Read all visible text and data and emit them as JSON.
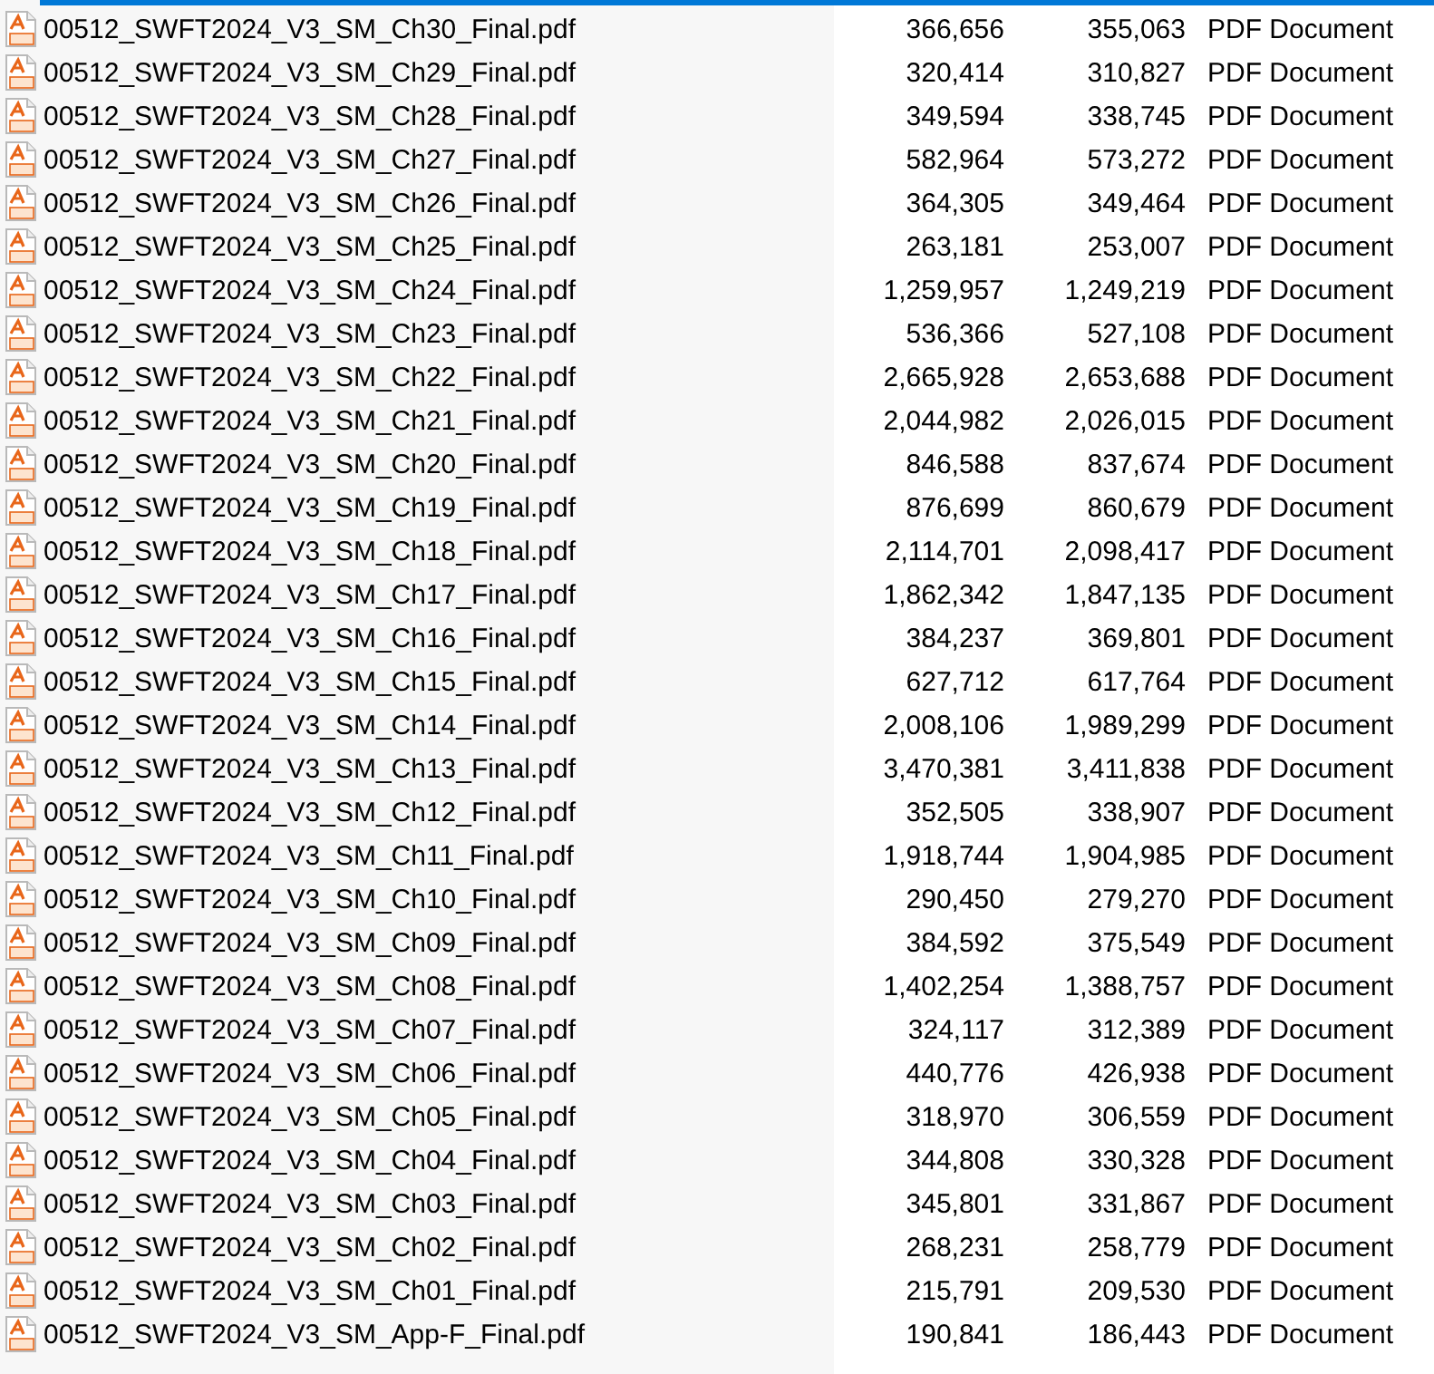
{
  "files": [
    {
      "name": "00512_SWFT2024_V3_SM_Ch30_Final.pdf",
      "column_2": "366,656",
      "column_3": "355,063",
      "column_4": "PDF Document"
    },
    {
      "name": "00512_SWFT2024_V3_SM_Ch29_Final.pdf",
      "column_2": "320,414",
      "column_3": "310,827",
      "column_4": "PDF Document"
    },
    {
      "name": "00512_SWFT2024_V3_SM_Ch28_Final.pdf",
      "column_2": "349,594",
      "column_3": "338,745",
      "column_4": "PDF Document"
    },
    {
      "name": "00512_SWFT2024_V3_SM_Ch27_Final.pdf",
      "column_2": "582,964",
      "column_3": "573,272",
      "column_4": "PDF Document"
    },
    {
      "name": "00512_SWFT2024_V3_SM_Ch26_Final.pdf",
      "column_2": "364,305",
      "column_3": "349,464",
      "column_4": "PDF Document"
    },
    {
      "name": "00512_SWFT2024_V3_SM_Ch25_Final.pdf",
      "column_2": "263,181",
      "column_3": "253,007",
      "column_4": "PDF Document"
    },
    {
      "name": "00512_SWFT2024_V3_SM_Ch24_Final.pdf",
      "column_2": "1,259,957",
      "column_3": "1,249,219",
      "column_4": "PDF Document"
    },
    {
      "name": "00512_SWFT2024_V3_SM_Ch23_Final.pdf",
      "column_2": "536,366",
      "column_3": "527,108",
      "column_4": "PDF Document"
    },
    {
      "name": "00512_SWFT2024_V3_SM_Ch22_Final.pdf",
      "column_2": "2,665,928",
      "column_3": "2,653,688",
      "column_4": "PDF Document"
    },
    {
      "name": "00512_SWFT2024_V3_SM_Ch21_Final.pdf",
      "column_2": "2,044,982",
      "column_3": "2,026,015",
      "column_4": "PDF Document"
    },
    {
      "name": "00512_SWFT2024_V3_SM_Ch20_Final.pdf",
      "column_2": "846,588",
      "column_3": "837,674",
      "column_4": "PDF Document"
    },
    {
      "name": "00512_SWFT2024_V3_SM_Ch19_Final.pdf",
      "column_2": "876,699",
      "column_3": "860,679",
      "column_4": "PDF Document"
    },
    {
      "name": "00512_SWFT2024_V3_SM_Ch18_Final.pdf",
      "column_2": "2,114,701",
      "column_3": "2,098,417",
      "column_4": "PDF Document"
    },
    {
      "name": "00512_SWFT2024_V3_SM_Ch17_Final.pdf",
      "column_2": "1,862,342",
      "column_3": "1,847,135",
      "column_4": "PDF Document"
    },
    {
      "name": "00512_SWFT2024_V3_SM_Ch16_Final.pdf",
      "column_2": "384,237",
      "column_3": "369,801",
      "column_4": "PDF Document"
    },
    {
      "name": "00512_SWFT2024_V3_SM_Ch15_Final.pdf",
      "column_2": "627,712",
      "column_3": "617,764",
      "column_4": "PDF Document"
    },
    {
      "name": "00512_SWFT2024_V3_SM_Ch14_Final.pdf",
      "column_2": "2,008,106",
      "column_3": "1,989,299",
      "column_4": "PDF Document"
    },
    {
      "name": "00512_SWFT2024_V3_SM_Ch13_Final.pdf",
      "column_2": "3,470,381",
      "column_3": "3,411,838",
      "column_4": "PDF Document"
    },
    {
      "name": "00512_SWFT2024_V3_SM_Ch12_Final.pdf",
      "column_2": "352,505",
      "column_3": "338,907",
      "column_4": "PDF Document"
    },
    {
      "name": "00512_SWFT2024_V3_SM_Ch11_Final.pdf",
      "column_2": "1,918,744",
      "column_3": "1,904,985",
      "column_4": "PDF Document"
    },
    {
      "name": "00512_SWFT2024_V3_SM_Ch10_Final.pdf",
      "column_2": "290,450",
      "column_3": "279,270",
      "column_4": "PDF Document"
    },
    {
      "name": "00512_SWFT2024_V3_SM_Ch09_Final.pdf",
      "column_2": "384,592",
      "column_3": "375,549",
      "column_4": "PDF Document"
    },
    {
      "name": "00512_SWFT2024_V3_SM_Ch08_Final.pdf",
      "column_2": "1,402,254",
      "column_3": "1,388,757",
      "column_4": "PDF Document"
    },
    {
      "name": "00512_SWFT2024_V3_SM_Ch07_Final.pdf",
      "column_2": "324,117",
      "column_3": "312,389",
      "column_4": "PDF Document"
    },
    {
      "name": "00512_SWFT2024_V3_SM_Ch06_Final.pdf",
      "column_2": "440,776",
      "column_3": "426,938",
      "column_4": "PDF Document"
    },
    {
      "name": "00512_SWFT2024_V3_SM_Ch05_Final.pdf",
      "column_2": "318,970",
      "column_3": "306,559",
      "column_4": "PDF Document"
    },
    {
      "name": "00512_SWFT2024_V3_SM_Ch04_Final.pdf",
      "column_2": "344,808",
      "column_3": "330,328",
      "column_4": "PDF Document"
    },
    {
      "name": "00512_SWFT2024_V3_SM_Ch03_Final.pdf",
      "column_2": "345,801",
      "column_3": "331,867",
      "column_4": "PDF Document"
    },
    {
      "name": "00512_SWFT2024_V3_SM_Ch02_Final.pdf",
      "column_2": "268,231",
      "column_3": "258,779",
      "column_4": "PDF Document"
    },
    {
      "name": "00512_SWFT2024_V3_SM_Ch01_Final.pdf",
      "column_2": "215,791",
      "column_3": "209,530",
      "column_4": "PDF Document"
    },
    {
      "name": "00512_SWFT2024_V3_SM_App-F_Final.pdf",
      "column_2": "190,841",
      "column_3": "186,443",
      "column_4": "PDF Document"
    }
  ]
}
